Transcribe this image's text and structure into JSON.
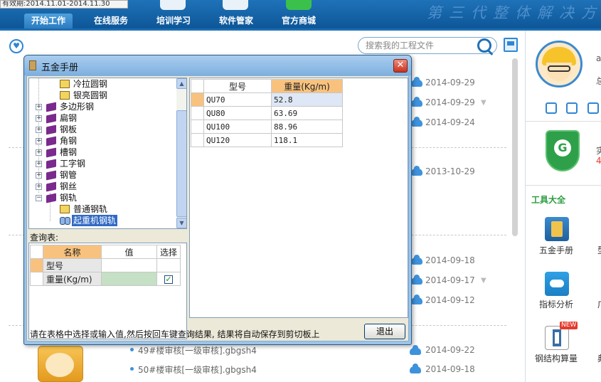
{
  "validity_text": "有效期:2014.11.01-2014.11.30",
  "nav": {
    "tabs": [
      "开始工作",
      "在线服务",
      "培训学习",
      "软件管家",
      "官方商城"
    ],
    "active_index": 0,
    "slogan": "第三代整体解决方"
  },
  "search": {
    "placeholder": "搜索我的工程文件"
  },
  "background_list": {
    "dates": [
      "2014-09-29",
      "2014-09-29",
      "2014-09-24",
      "2013-10-29",
      "2014-09-18",
      "2014-09-17",
      "2014-09-12",
      "2014-09-22",
      "2014-09-18"
    ],
    "files": [
      "49#楼审核[一级审核].gbgsh4",
      "50#楼审核[一级审核].gbgsh4"
    ]
  },
  "right_panel": {
    "user_partial": [
      "a",
      "总"
    ],
    "shield_partial": [
      "实",
      "4"
    ],
    "tools_title": "工具大全",
    "tools": [
      {
        "label": "五金手册",
        "icon": "handbook-icon",
        "side": "型"
      },
      {
        "label": "指标分析",
        "icon": "index-analysis-icon",
        "side": "广"
      },
      {
        "label": "钢结构算量",
        "icon": "steel-structure-icon",
        "side": "典"
      }
    ],
    "new_badge": "NEW"
  },
  "dialog": {
    "title": "五金手册",
    "tree": [
      {
        "label": "冷拉圆钢",
        "kind": "leaf",
        "level": 2
      },
      {
        "label": "银亮圆钢",
        "kind": "leaf",
        "level": 2
      },
      {
        "label": "多边形钢",
        "kind": "group",
        "level": 1,
        "expanded": false
      },
      {
        "label": "扁钢",
        "kind": "group",
        "level": 1,
        "expanded": false
      },
      {
        "label": "钢板",
        "kind": "group",
        "level": 1,
        "expanded": false
      },
      {
        "label": "角钢",
        "kind": "group",
        "level": 1,
        "expanded": false
      },
      {
        "label": "槽钢",
        "kind": "group",
        "level": 1,
        "expanded": false
      },
      {
        "label": "工字钢",
        "kind": "group",
        "level": 1,
        "expanded": false
      },
      {
        "label": "钢管",
        "kind": "group",
        "level": 1,
        "expanded": false
      },
      {
        "label": "钢丝",
        "kind": "group",
        "level": 1,
        "expanded": false
      },
      {
        "label": "钢轨",
        "kind": "group",
        "level": 1,
        "expanded": true
      },
      {
        "label": "普通钢轨",
        "kind": "leaf",
        "level": 2
      },
      {
        "label": "起重机钢轨",
        "kind": "leaf-search",
        "level": 2,
        "selected": true
      }
    ],
    "query_label": "查询表:",
    "query_table": {
      "headers": [
        "名称",
        "值",
        "选择"
      ],
      "rows": [
        {
          "name": "型号",
          "value": "",
          "checked": false
        },
        {
          "name": "重量(Kg/m)",
          "value": "",
          "checked": true
        }
      ]
    },
    "result_table": {
      "headers": [
        "型号",
        "重量(Kg/m)"
      ],
      "rows": [
        [
          "QU70",
          "52.8"
        ],
        [
          "QU80",
          "63.69"
        ],
        [
          "QU100",
          "88.96"
        ],
        [
          "QU120",
          "118.1"
        ]
      ]
    },
    "hint": "请在表格中选择或输入值,然后按回车键查询结果, 结果将自动保存到剪切板上",
    "exit_label": "退出"
  },
  "colors": {
    "header_blue": "#1f72b8",
    "dialog_frame": "#9cc3e8",
    "highlight_orange": "#f8c27e",
    "selection_blue": "#316ac5"
  }
}
